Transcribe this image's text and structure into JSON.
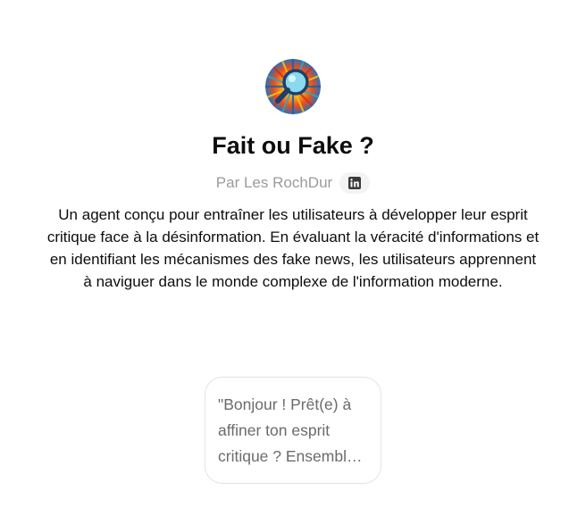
{
  "gpt": {
    "avatar_icon": "magnifying-glass-sunburst-icon",
    "title": "Fait ou Fake ?",
    "author_byline": "Par Les RochDur",
    "linkedin_icon": "linkedin-icon",
    "description": "Un agent conçu pour entraîner les utilisateurs à développer leur esprit critique face à la désinformation. En évaluant la véracité d'informations et en identifiant les mécanismes des fake news, les utilisateurs apprennent à naviguer dans le monde complexe de l'information moderne."
  },
  "conversation_starters": [
    {
      "text": "\"Bonjour ! Prêt(e) à affiner ton esprit critique ? Ensemble, démêlons le vrai du faux !\""
    }
  ],
  "colors": {
    "title": "#0d0d0d",
    "byline": "#9b9b9b",
    "starter_text": "#6b6b6b",
    "card_border": "#e3e3e3"
  }
}
